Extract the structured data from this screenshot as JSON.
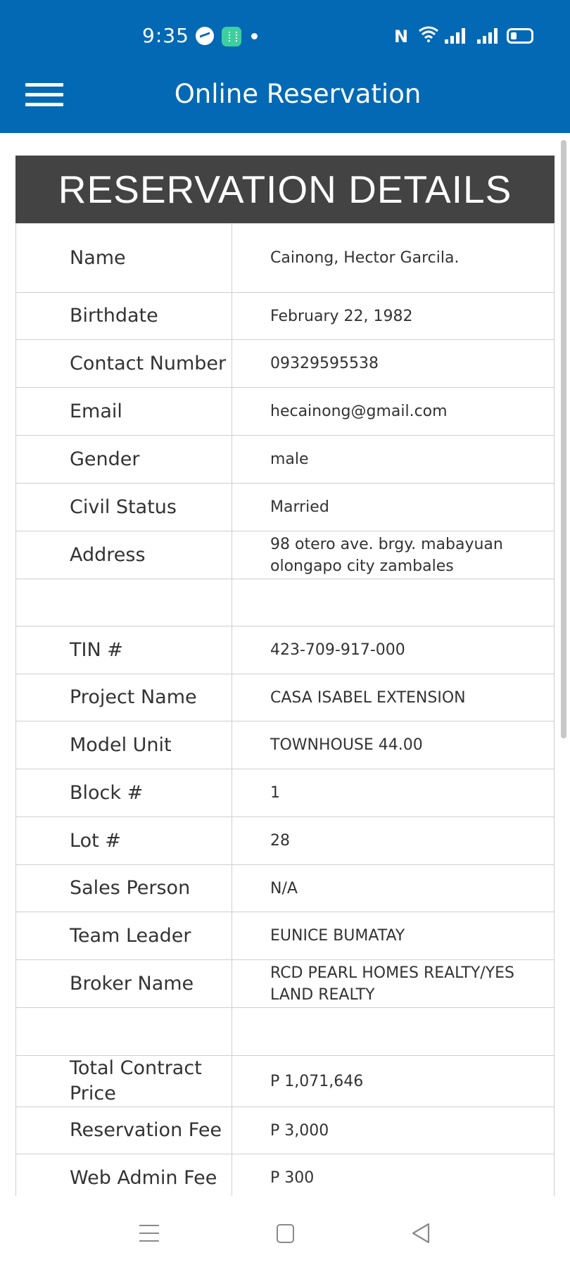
{
  "status_bar": {
    "time": "9:35",
    "icons": [
      "messenger-icon",
      "app-notification-icon",
      "notification-dot-icon",
      "nfc-icon",
      "wifi-icon",
      "signal-icon",
      "signal-icon",
      "battery-icon"
    ],
    "nfc_glyph": "N"
  },
  "app_bar": {
    "menu_icon": "hamburger-menu-icon",
    "title": "Online Reservation",
    "color": "#0369b5"
  },
  "details": {
    "header": "RESERVATION DETAILS",
    "header_color": "#434344",
    "rows": [
      {
        "label": "Name",
        "value": "Cainong, Hector Garcila."
      },
      {
        "label": "Birthdate",
        "value": "February 22, 1982"
      },
      {
        "label": "Contact Number",
        "value": "09329595538"
      },
      {
        "label": "Email",
        "value": "hecainong@gmail.com"
      },
      {
        "label": "Gender",
        "value": "male"
      },
      {
        "label": "Civil Status",
        "value": "Married"
      },
      {
        "label": "Address",
        "value": "98 otero ave. brgy. mabayuan olongapo city zambales"
      },
      {
        "label": "",
        "value": ""
      },
      {
        "label": "TIN #",
        "value": "423-709-917-000"
      },
      {
        "label": "Project Name",
        "value": "CASA ISABEL EXTENSION"
      },
      {
        "label": "Model Unit",
        "value": "TOWNHOUSE 44.00"
      },
      {
        "label": "Block #",
        "value": "1"
      },
      {
        "label": "Lot #",
        "value": "28"
      },
      {
        "label": "Sales Person",
        "value": "N/A"
      },
      {
        "label": "Team Leader",
        "value": "EUNICE BUMATAY"
      },
      {
        "label": "Broker Name",
        "value": "RCD PEARL HOMES REALTY/YES LAND REALTY"
      },
      {
        "label": "",
        "value": ""
      },
      {
        "label": "Total Contract Price",
        "value": "P 1,071,646"
      },
      {
        "label": "Reservation Fee",
        "value": "P 3,000"
      },
      {
        "label": "Web Admin Fee",
        "value": "P 300"
      }
    ]
  },
  "nav_bar": {
    "icons": [
      "recent-apps-icon",
      "home-icon",
      "back-icon"
    ]
  }
}
